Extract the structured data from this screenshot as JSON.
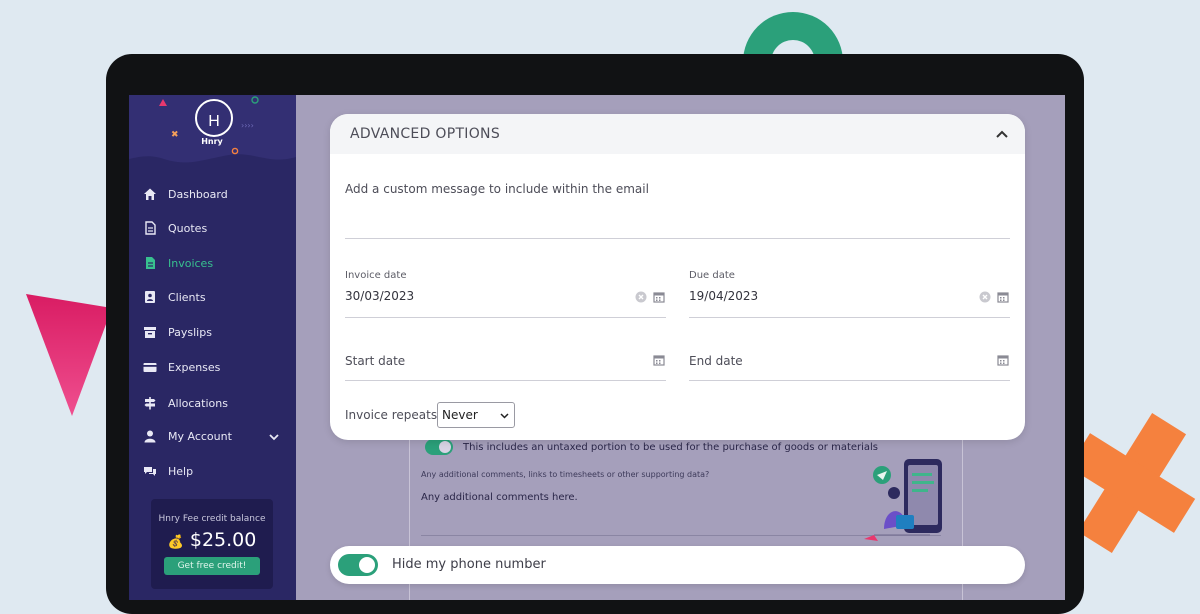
{
  "sidebar": {
    "logo_text": "Hnry",
    "items": [
      {
        "label": "Dashboard",
        "icon": "home-icon"
      },
      {
        "label": "Quotes",
        "icon": "document-icon"
      },
      {
        "label": "Invoices",
        "icon": "invoice-icon",
        "active": true
      },
      {
        "label": "Clients",
        "icon": "contacts-icon"
      },
      {
        "label": "Payslips",
        "icon": "archive-icon"
      },
      {
        "label": "Expenses",
        "icon": "card-icon"
      },
      {
        "label": "Allocations",
        "icon": "signpost-icon"
      },
      {
        "label": "My Account",
        "icon": "user-icon"
      },
      {
        "label": "Help",
        "icon": "chat-icon"
      }
    ],
    "credit": {
      "title": "Hnry Fee credit balance",
      "amount": "$25.00",
      "button": "Get free credit!"
    }
  },
  "advanced": {
    "title": "ADVANCED OPTIONS",
    "custom_message_placeholder": "Add a custom message to include within the email",
    "invoice_date_label": "Invoice date",
    "invoice_date_value": "30/03/2023",
    "due_date_label": "Due date",
    "due_date_value": "19/04/2023",
    "start_date_placeholder": "Start date",
    "end_date_placeholder": "End date",
    "repeats_label": "Invoice repeats",
    "repeats_value": "Never"
  },
  "background_form": {
    "untaxed_text": "This includes an untaxed portion to be used for the purchase of goods or materials",
    "comments_label": "Any additional comments, links to timesheets or other supporting data?",
    "comments_placeholder": "Any additional comments here."
  },
  "phone_toggle": {
    "label": "Hide my phone number",
    "checked": true
  },
  "colors": {
    "sidebar": "#2a2764",
    "accent": "#2ba07a",
    "overlay": "#a59fbb"
  }
}
